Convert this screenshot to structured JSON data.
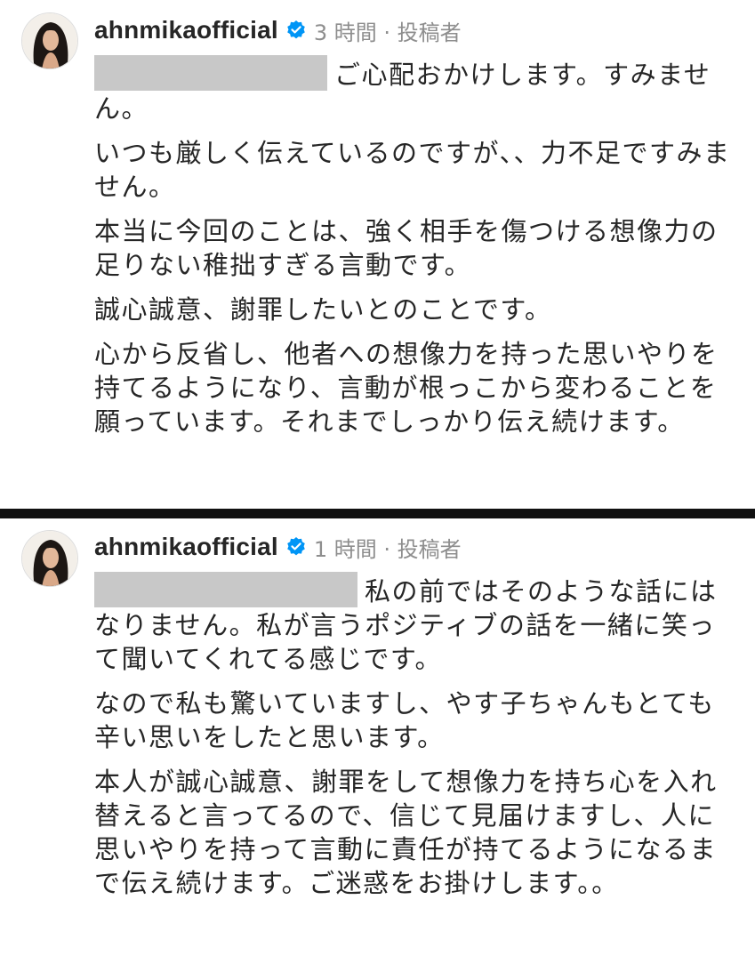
{
  "comments": [
    {
      "username": "ahnmikaofficial",
      "verified_icon": "verified-badge-icon",
      "meta": "3 時間 · 投稿者",
      "paragraphs": [
        "ご心配おかけします。すみません。",
        "いつも厳しく伝えているのですが、、力不足ですみません。",
        "本当に今回のことは、強く相手を傷つける想像力の足りない稚拙すぎる言動です。",
        "誠心誠意、謝罪したいとのことです。",
        "心から反省し、他者への想像力を持った思いやりを持てるようになり、言動が根っこから変わることを願っています。それまでしっかり伝え続けます。"
      ]
    },
    {
      "username": "ahnmikaofficial",
      "verified_icon": "verified-badge-icon",
      "meta": "1 時間 · 投稿者",
      "paragraphs": [
        "私の前ではそのような話にはなりません。私が言うポジティブの話を一緒に笑って聞いてくれてる感じです。",
        "なので私も驚いていますし、やす子ちゃんもとても辛い思いをしたと思います。",
        "本人が誠心誠意、謝罪をして想像力を持ち心を入れ替えると言ってるので、信じて見届けますし、人に思いやりを持って言動に責任が持てるようになるまで伝え続けます。ご迷惑をお掛けします。。"
      ]
    }
  ],
  "colors": {
    "verified_blue": "#0095f6",
    "meta_gray": "#8e8e8e",
    "redaction_gray": "#c8c8c8",
    "divider": "#111111"
  }
}
